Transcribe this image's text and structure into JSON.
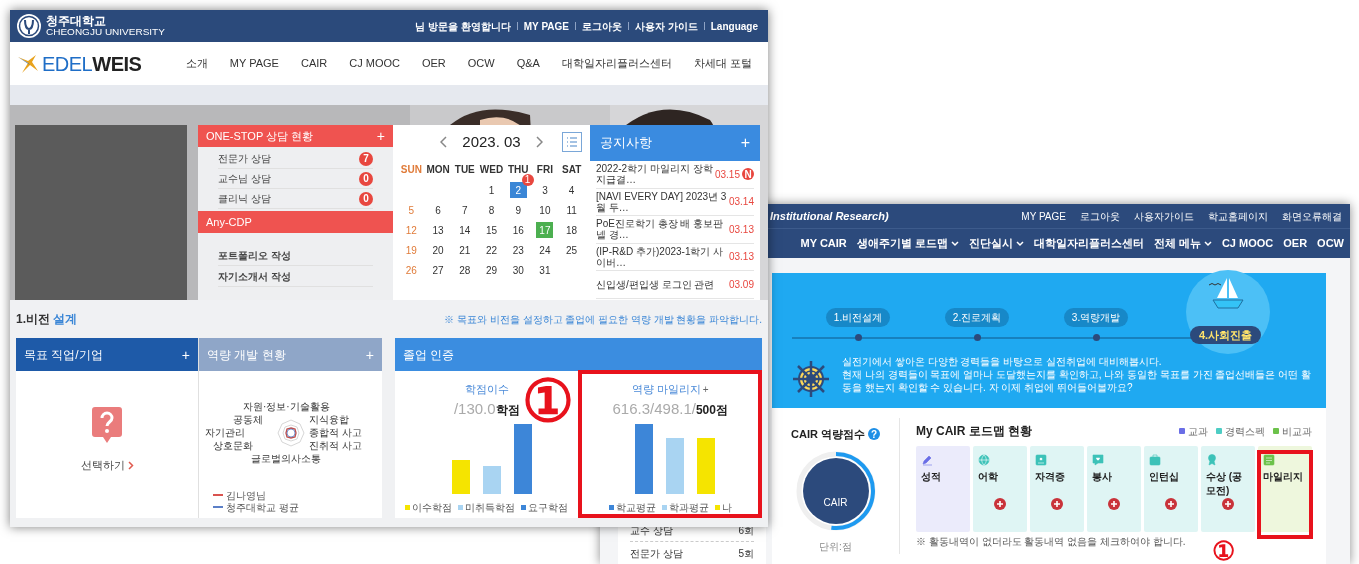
{
  "front_window": {
    "top_bar": {
      "logo_name": "청주대학교",
      "logo_subtitle": "CHEONGJU UNIVERSITY",
      "links": [
        "님 방문을 환영합니다",
        "MY PAGE",
        "로그아웃",
        "사용자 가이드",
        "Language"
      ]
    },
    "nav": {
      "logo_parts": [
        "EDEL",
        "WEIS"
      ],
      "items": [
        "소개",
        "MY PAGE",
        "CAIR",
        "CJ MOOC",
        "OER",
        "OCW",
        "Q&A",
        "대학일자리플러스센터",
        "차세대 포털"
      ]
    },
    "consult": {
      "title": "ONE-STOP 상담 현황",
      "add": "+",
      "items": [
        {
          "label": "전문가 상담",
          "count": "7"
        },
        {
          "label": "교수님 상담",
          "count": "0"
        },
        {
          "label": "클리닉 상담",
          "count": "0"
        }
      ],
      "cdp_title": "Any-CDP",
      "cdp_items": [
        "포트폴리오 작성",
        "자기소개서 작성"
      ]
    },
    "calendar": {
      "month": "2023. 03",
      "weekdays": [
        "SUN",
        "MON",
        "TUE",
        "WED",
        "THU",
        "FRI",
        "SAT"
      ],
      "weeks": [
        {
          "starts_mid_week": true,
          "days": [
            {
              "day": "1",
              "selected": false,
              "today": false
            },
            {
              "day": "2",
              "selected": true,
              "today": false,
              "events": "1"
            },
            {
              "day": "3",
              "selected": false,
              "today": false
            },
            {
              "day": "4",
              "selected": false,
              "today": false
            }
          ]
        },
        {
          "days": [
            {
              "day": "5",
              "selected": false,
              "today": false
            },
            {
              "day": "6",
              "selected": false,
              "today": false
            },
            {
              "day": "7",
              "selected": false,
              "today": false
            },
            {
              "day": "8",
              "selected": false,
              "today": false
            },
            {
              "day": "9",
              "selected": false,
              "today": false
            },
            {
              "day": "10",
              "selected": false,
              "today": false
            },
            {
              "day": "11",
              "selected": false,
              "today": false
            }
          ]
        },
        {
          "days": [
            {
              "day": "12",
              "selected": false,
              "today": false
            },
            {
              "day": "13",
              "selected": false,
              "today": false
            },
            {
              "day": "14",
              "selected": false,
              "today": false
            },
            {
              "day": "15",
              "selected": false,
              "today": false
            },
            {
              "day": "16",
              "selected": false,
              "today": false
            },
            {
              "day": "17",
              "selected": false,
              "today": true
            },
            {
              "day": "18",
              "selected": false,
              "today": false
            }
          ]
        },
        {
          "days": [
            {
              "day": "19",
              "selected": false,
              "today": false
            },
            {
              "day": "20",
              "selected": false,
              "today": false
            },
            {
              "day": "21",
              "selected": false,
              "today": false
            },
            {
              "day": "22",
              "selected": false,
              "today": false
            },
            {
              "day": "23",
              "selected": false,
              "today": false
            },
            {
              "day": "24",
              "selected": false,
              "today": false
            },
            {
              "day": "25",
              "selected": false,
              "today": false
            }
          ]
        },
        {
          "days": [
            {
              "day": "26",
              "selected": false,
              "today": false
            },
            {
              "day": "27",
              "selected": false,
              "today": false
            },
            {
              "day": "28",
              "selected": false,
              "today": false
            },
            {
              "day": "29",
              "selected": false,
              "today": false
            },
            {
              "day": "30",
              "selected": false,
              "today": false
            },
            {
              "day": "31",
              "selected": false,
              "today": false
            }
          ]
        }
      ]
    },
    "notices": {
      "title": "공지사항",
      "add": "+",
      "items": [
        {
          "title": "2022-2학기 마일리지 장학 지급결…",
          "date": "03.15",
          "new": true,
          "badge": "N"
        },
        {
          "title": "[NAVI EVERY DAY] 2023년 3월 두…",
          "date": "03.14",
          "new": false
        },
        {
          "title": "PoE진로학기 총장 배 홍보판넬 경…",
          "date": "03.13",
          "new": false
        },
        {
          "title": "(IP-R&D 추가)2023-1학기 사이버…",
          "date": "03.13",
          "new": false
        },
        {
          "title": "신입생/편입생 로그인 관련",
          "date": "03.09",
          "new": false
        }
      ]
    },
    "vision": {
      "title": "1.비전",
      "title_accent": "설계",
      "note": "※ 목표와 비전을 설정하고 졸업에 필요한 역량 개발 현황을 파악합니다.",
      "goal": {
        "title": "목표 직업/기업",
        "add": "+",
        "action": "선택하기"
      },
      "competency": {
        "title": "역량 개발 현황",
        "add": "+",
        "radar_labels": [
          "자원·정보·기술활용",
          "공동체",
          "지식융합",
          "자기관리",
          "종합적 사고",
          "상호문화",
          "진취적 사고",
          "글로벌의사소통"
        ],
        "legend": [
          {
            "label": "김나영님",
            "color": "#d9534f"
          },
          {
            "label": "청주대학교 평균",
            "color": "#5b7fc7"
          }
        ]
      },
      "graduation": {
        "title": "졸업 인증",
        "credits": {
          "title": "학점이수",
          "value": "/130.0**학점**",
          "legend": [
            {
              "label": "이수학점",
              "color": "#f5e400"
            },
            {
              "label": "미취득학점",
              "color": "#a9d4f2"
            },
            {
              "label": "요구학점",
              "color": "#3d86d8"
            }
          ]
        },
        "mileage": {
          "title": "역량 마일리지",
          "add": "+",
          "value": "616.3/498.1/**500점**",
          "legend": [
            {
              "label": "학교평균",
              "color": "#3d86d8"
            },
            {
              "label": "학과평균",
              "color": "#a9d4f2"
            },
            {
              "label": "나",
              "color": "#f5e400"
            }
          ]
        }
      }
    }
  },
  "back_window": {
    "header": {
      "title": "Institutional Research)",
      "links": [
        "MY PAGE",
        "로그아웃",
        "사용자가이드",
        "학교홈페이지",
        "화면오류해결"
      ]
    },
    "nav": [
      {
        "label": "MY CAIR",
        "dropdown": false
      },
      {
        "label": "생애주기별 로드맵",
        "dropdown": true
      },
      {
        "label": "진단실시",
        "dropdown": true
      },
      {
        "label": "대학일자리플러스센터",
        "dropdown": false
      },
      {
        "label": "전체 메뉴",
        "dropdown": true
      },
      {
        "label": "CJ MOOC",
        "dropdown": false
      },
      {
        "label": "OER",
        "dropdown": false
      },
      {
        "label": "OCW",
        "dropdown": false
      }
    ],
    "banner": {
      "steps": [
        {
          "label": "1.비전설계",
          "selected": false
        },
        {
          "label": "2.진로계획",
          "selected": false
        },
        {
          "label": "3.역량개발",
          "selected": false
        },
        {
          "label": "4.사회진출",
          "selected": true
        }
      ],
      "message": [
        "실전기에서 쌓아온 다양한 경력들을 바탕으로 실전취업에 대비해봅시다.",
        "현재 나의 경력들이 목표에 얼마나 도달했는지를 확인하고, 나와 동일한 목표를 가진 졸업선배들은 어떤 활동을 했는지 확인할 수 있습니다. 자 이제 취업에 뛰어들어볼까요?"
      ]
    },
    "score": {
      "title": "CAIR 역량점수",
      "help": "?",
      "gauge_label": "CAIR",
      "level": 0.52,
      "unit": "단위:점"
    },
    "roadmap": {
      "title": "My CAIR 로드맵 현황",
      "legend": [
        {
          "label": "교과",
          "color": "#6a6ee6"
        },
        {
          "label": "경력스펙",
          "color": "#4ecdc4"
        },
        {
          "label": "비교과",
          "color": "#6cc24a"
        }
      ],
      "cards": [
        {
          "label": "성적",
          "kind": "curricular",
          "add_button": false
        },
        {
          "label": "어학",
          "kind": "career",
          "add_button": true
        },
        {
          "label": "자격증",
          "kind": "career",
          "add_button": true
        },
        {
          "label": "봉사",
          "kind": "career",
          "add_button": true
        },
        {
          "label": "인턴십",
          "kind": "career",
          "add_button": true
        },
        {
          "label": "수상 (공모전)",
          "kind": "career",
          "add_button": true
        },
        {
          "label": "마일리지",
          "kind": "extra",
          "add_button": false
        }
      ],
      "footnote": "※ 활동내역이 없더라도 활동내역 없음을 체크하여야 합니다."
    },
    "consult_summary": [
      {
        "label": "교수 상담",
        "count": "6회"
      },
      {
        "label": "전문가 상담",
        "count": "5회"
      }
    ]
  },
  "annotations": [
    {
      "text": "①"
    },
    {
      "text": "①"
    }
  ]
}
